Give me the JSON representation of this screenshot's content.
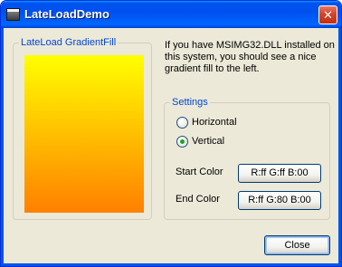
{
  "window": {
    "title": "LateLoadDemo",
    "title_icon": "app-window-icon",
    "close_glyph": "✕"
  },
  "gradient_group": {
    "label": "LateLoad GradientFill",
    "gradient_colors": [
      "#ffff00",
      "#ff8000"
    ]
  },
  "info": {
    "text": "If you have MSIMG32.DLL installed on this system, you should see a nice gradient fill to the left."
  },
  "settings": {
    "label": "Settings",
    "options": [
      {
        "label": "Horizontal",
        "selected": false
      },
      {
        "label": "Vertical",
        "selected": true
      }
    ],
    "start_color_label": "Start Color",
    "start_color_value": "R:ff G:ff B:00",
    "end_color_label": "End Color",
    "end_color_value": "R:ff G:80 B:00"
  },
  "footer": {
    "close_label": "Close"
  }
}
